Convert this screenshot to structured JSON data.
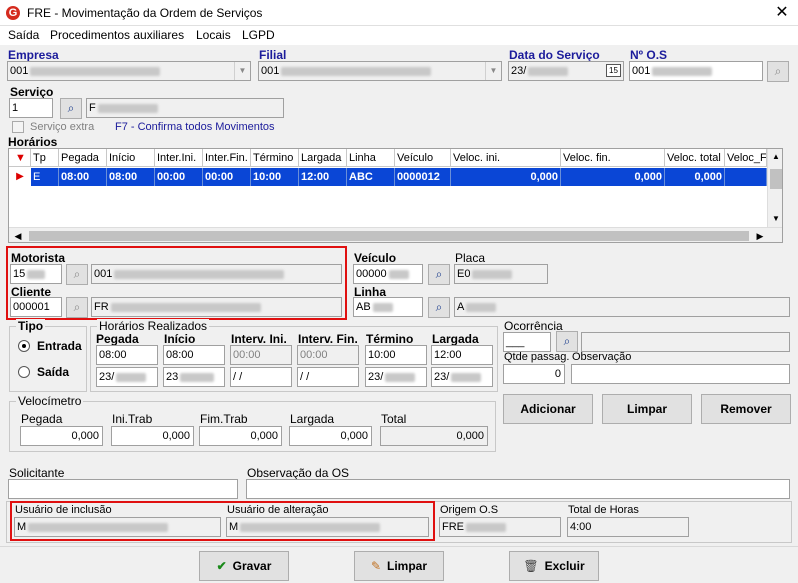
{
  "window": {
    "title": "FRE - Movimentação da Ordem de Serviços",
    "close_glyph": "✕",
    "logo_letter": "G"
  },
  "menu": [
    "Saída",
    "Procedimentos auxiliares",
    "Locais",
    "LGPD"
  ],
  "header": {
    "empresa": {
      "label": "Empresa",
      "value": "001"
    },
    "filial": {
      "label": "Filial",
      "value": "001"
    },
    "data_servico": {
      "label": "Data do Serviço",
      "value": "23/",
      "cal": "15"
    },
    "nos": {
      "label": "Nº O.S",
      "value": "001"
    }
  },
  "servico": {
    "label": "Serviço",
    "value": "1",
    "desc": "F",
    "extra_label": "Serviço extra",
    "hint": "F7 - Confirma todos Movimentos"
  },
  "horarios": {
    "label": "Horários",
    "columns": [
      "Tp",
      "Pegada",
      "Início",
      "Inter.Ini.",
      "Inter.Fin.",
      "Término",
      "Largada",
      "Linha",
      "Veículo",
      "Veloc. ini.",
      "Veloc. fin.",
      "Veloc. total",
      "Veloc_Fi"
    ],
    "rows": [
      [
        "E",
        "08:00",
        "08:00",
        "00:00",
        "00:00",
        "10:00",
        "12:00",
        "ABC",
        "0000012",
        "0,000",
        "0,000",
        "0,000",
        ""
      ]
    ]
  },
  "motorista": {
    "label": "Motorista",
    "code": "15",
    "name": "001"
  },
  "cliente": {
    "label": "Cliente",
    "code": "000001",
    "name": "FR"
  },
  "veiculo": {
    "label": "Veículo",
    "code": "00000",
    "placa_label": "Placa",
    "placa": "E0"
  },
  "linha": {
    "label": "Linha",
    "code": "AB",
    "name": "A"
  },
  "tipo": {
    "label": "Tipo",
    "entrada": "Entrada",
    "saida": "Saída"
  },
  "realizados": {
    "label": "Horários Realizados",
    "cols": [
      "Pegada",
      "Início",
      "Interv. Ini.",
      "Interv. Fin.",
      "Término",
      "Largada"
    ],
    "times": [
      "08:00",
      "08:00",
      "00:00",
      "00:00",
      "10:00",
      "12:00"
    ],
    "dates": [
      "23/",
      "23",
      " / /",
      " / /",
      "23/",
      "23/"
    ]
  },
  "ocorrencia": {
    "label": "Ocorrência",
    "value": "___"
  },
  "qtde": {
    "label": "Qtde passag.",
    "value": "0"
  },
  "observacao": {
    "label": "Observação",
    "value": ""
  },
  "velocimetro": {
    "label": "Velocímetro",
    "fields": [
      {
        "label": "Pegada",
        "value": "0,000"
      },
      {
        "label": "Ini.Trab",
        "value": "0,000"
      },
      {
        "label": "Fim.Trab",
        "value": "0,000"
      },
      {
        "label": "Largada",
        "value": "0,000"
      },
      {
        "label": "Total",
        "value": "0,000"
      }
    ]
  },
  "actions": {
    "adicionar": "Adicionar",
    "limpar": "Limpar",
    "remover": "Remover"
  },
  "solicitante": {
    "label": "Solicitante",
    "value": ""
  },
  "obs_os": {
    "label": "Observação da OS",
    "value": ""
  },
  "usuario_inclusao": {
    "label": "Usuário de inclusão",
    "value": "M"
  },
  "usuario_alteracao": {
    "label": "Usuário de alteração",
    "value": "M"
  },
  "origem_os": {
    "label": "Origem O.S",
    "value": "FRE"
  },
  "total_horas": {
    "label": "Total de Horas",
    "value": "4:00"
  },
  "footer": {
    "gravar": "Gravar",
    "limpar": "Limpar",
    "excluir": "Excluir"
  },
  "colors": {
    "selection": "#0a46d6",
    "highlight_box": "#e01010",
    "label_blue": "#1b1b9b"
  }
}
